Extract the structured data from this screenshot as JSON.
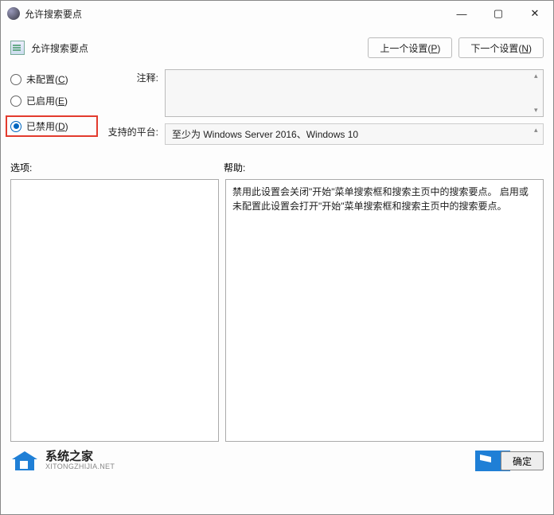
{
  "window": {
    "title": "允许搜索要点"
  },
  "header": {
    "title": "允许搜索要点",
    "prev_button": "上一个设置(",
    "prev_key": "P",
    "next_button": "下一个设置(",
    "next_key": "N",
    "paren_close": ")"
  },
  "radios": {
    "not_configured": "未配置(",
    "not_configured_key": "C",
    "enabled": "已启用(",
    "enabled_key": "E",
    "disabled": "已禁用(",
    "disabled_key": "D",
    "paren_close": ")",
    "selected": "disabled"
  },
  "labels": {
    "comment": "注释:",
    "platform": "支持的平台:",
    "options": "选项:",
    "help": "帮助:"
  },
  "platform_text": "至少为 Windows Server 2016、Windows 10",
  "help_text": "禁用此设置会关闭\"开始\"菜单搜索框和搜索主页中的搜索要点。 启用或未配置此设置会打开\"开始\"菜单搜索框和搜索主页中的搜索要点。",
  "footer": {
    "brand_cn": "系统之家",
    "brand_en": "XITONGZHIJIA.NET",
    "ok": "确定"
  }
}
